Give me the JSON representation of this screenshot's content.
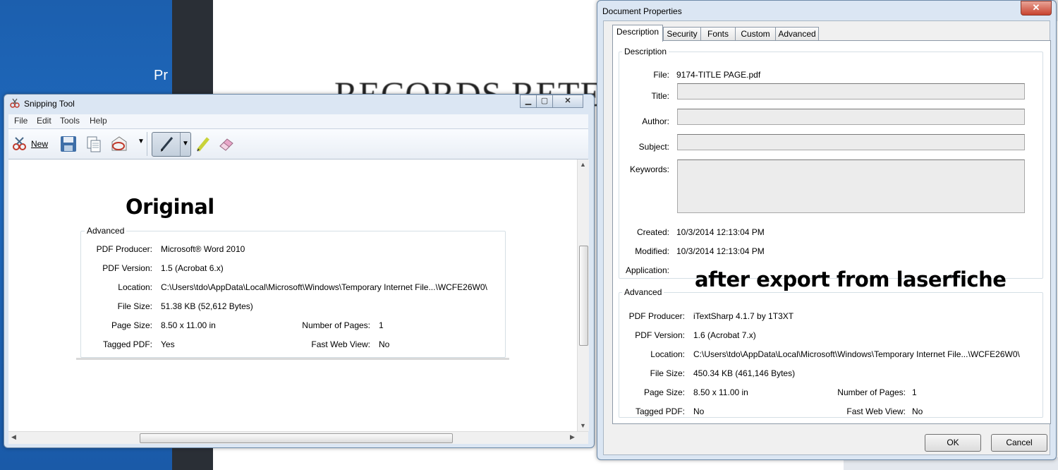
{
  "desktop": {
    "left_text": "Pr",
    "document_heading": "RECORDS RETE"
  },
  "snipping_tool": {
    "title": "Snipping Tool",
    "menu": [
      "File",
      "Edit",
      "Tools",
      "Help"
    ],
    "toolbar": {
      "new_label": "New"
    },
    "annotation": "Original",
    "advanced": {
      "group_label": "Advanced",
      "pdf_producer_label": "PDF Producer:",
      "pdf_producer": "Microsoft® Word 2010",
      "pdf_version_label": "PDF Version:",
      "pdf_version": "1.5 (Acrobat 6.x)",
      "location_label": "Location:",
      "location": "C:\\Users\\tdo\\AppData\\Local\\Microsoft\\Windows\\Temporary Internet File...\\WCFE26W0\\",
      "file_size_label": "File Size:",
      "file_size": "51.38 KB (52,612 Bytes)",
      "page_size_label": "Page Size:",
      "page_size": "8.50 x 11.00 in",
      "num_pages_label": "Number of Pages:",
      "num_pages": "1",
      "tagged_pdf_label": "Tagged PDF:",
      "tagged_pdf": "Yes",
      "fast_web_label": "Fast Web View:",
      "fast_web": "No"
    }
  },
  "document_properties": {
    "title": "Document Properties",
    "tabs": [
      "Description",
      "Security",
      "Fonts",
      "Custom",
      "Advanced"
    ],
    "description": {
      "group_label": "Description",
      "file_label": "File:",
      "file": "9174-TITLE PAGE.pdf",
      "title_label": "Title:",
      "title": "",
      "author_label": "Author:",
      "author": "",
      "subject_label": "Subject:",
      "subject": "",
      "keywords_label": "Keywords:",
      "keywords": "",
      "created_label": "Created:",
      "created": "10/3/2014 12:13:04 PM",
      "modified_label": "Modified:",
      "modified": "10/3/2014 12:13:04 PM",
      "application_label": "Application:",
      "application": ""
    },
    "annotation": "after export from laserfiche",
    "advanced": {
      "group_label": "Advanced",
      "pdf_producer_label": "PDF Producer:",
      "pdf_producer": "iTextSharp 4.1.7 by 1T3XT",
      "pdf_version_label": "PDF Version:",
      "pdf_version": "1.6 (Acrobat 7.x)",
      "location_label": "Location:",
      "location": "C:\\Users\\tdo\\AppData\\Local\\Microsoft\\Windows\\Temporary Internet File...\\WCFE26W0\\",
      "file_size_label": "File Size:",
      "file_size": "450.34 KB (461,146 Bytes)",
      "page_size_label": "Page Size:",
      "page_size": "8.50 x 11.00 in",
      "num_pages_label": "Number of Pages:",
      "num_pages": "1",
      "tagged_pdf_label": "Tagged PDF:",
      "tagged_pdf": "No",
      "fast_web_label": "Fast Web View:",
      "fast_web": "No"
    },
    "buttons": {
      "ok": "OK",
      "cancel": "Cancel"
    },
    "close_glyph": "✕"
  }
}
